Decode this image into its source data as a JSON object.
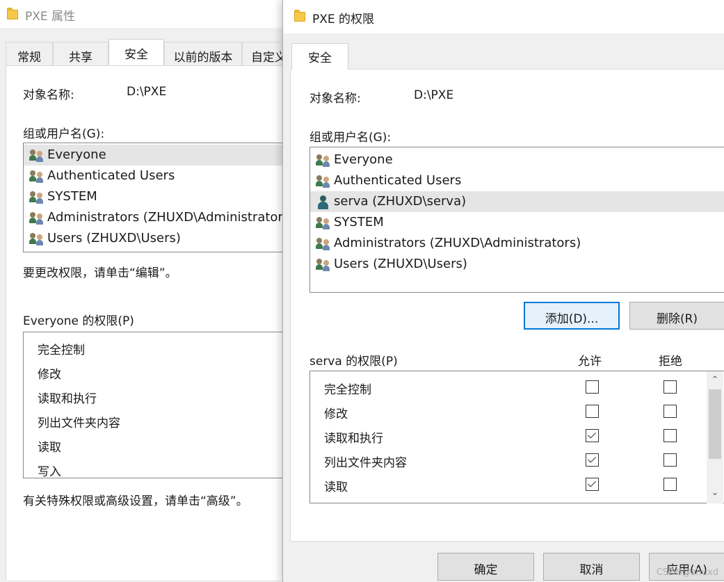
{
  "back": {
    "title": "PXE 属性",
    "tabs": [
      "常规",
      "共享",
      "安全",
      "以前的版本",
      "自定义"
    ],
    "object_label": "对象名称:",
    "object_value": "D:\\PXE",
    "group_label": "组或用户名(G):",
    "users": [
      "Everyone",
      "Authenticated Users",
      "SYSTEM",
      "Administrators (ZHUXD\\Administrators)",
      "Users (ZHUXD\\Users)"
    ],
    "edit_hint": "要更改权限，请单击“编辑”。",
    "perm_label": "Everyone 的权限(P)",
    "perms": [
      "完全控制",
      "修改",
      "读取和执行",
      "列出文件夹内容",
      "读取",
      "写入"
    ],
    "advanced_hint": "有关特殊权限或高级设置，请单击“高级”。"
  },
  "front": {
    "title": "PXE 的权限",
    "tab": "安全",
    "object_label": "对象名称:",
    "object_value": "D:\\PXE",
    "group_label": "组或用户名(G):",
    "users": [
      "Everyone",
      "Authenticated Users",
      "serva (ZHUXD\\serva)",
      "SYSTEM",
      "Administrators (ZHUXD\\Administrators)",
      "Users (ZHUXD\\Users)"
    ],
    "add_button": "添加(D)...",
    "remove_button": "删除(R)",
    "perm_label": "serva 的权限(P)",
    "allow_header": "允许",
    "deny_header": "拒绝",
    "perms": [
      {
        "name": "完全控制",
        "allow": false,
        "deny": false
      },
      {
        "name": "修改",
        "allow": false,
        "deny": false
      },
      {
        "name": "读取和执行",
        "allow": true,
        "deny": false
      },
      {
        "name": "列出文件夹内容",
        "allow": true,
        "deny": false
      },
      {
        "name": "读取",
        "allow": true,
        "deny": false
      }
    ],
    "ok_button": "确定",
    "cancel_button": "取消",
    "apply_button": "应用(A)"
  },
  "watermark": "CSDN@zhuxd"
}
